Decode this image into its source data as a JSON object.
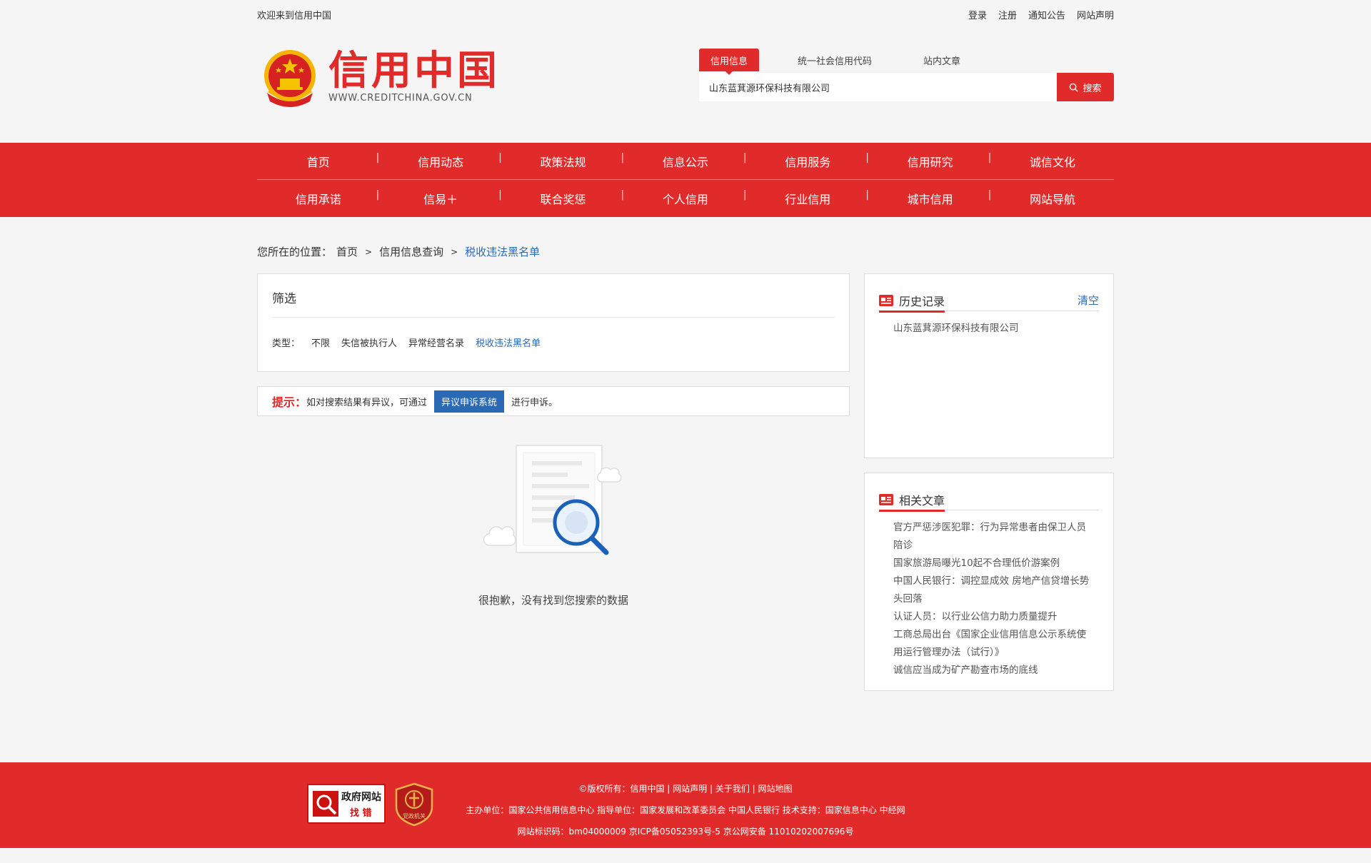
{
  "topbar": {
    "welcome": "欢迎来到信用中国",
    "links": [
      "登录",
      "注册",
      "通知公告",
      "网站声明"
    ]
  },
  "logo": {
    "title": "信用中国",
    "subtitle": "WWW.CREDITCHINA.GOV.CN"
  },
  "search": {
    "tabs": [
      "信用信息",
      "统一社会信用代码",
      "站内文章"
    ],
    "active_tab": "信用信息",
    "value": "山东蓝萁源环保科技有限公司",
    "button": "搜索"
  },
  "nav": {
    "row1": [
      "首页",
      "信用动态",
      "政策法规",
      "信息公示",
      "信用服务",
      "信用研究",
      "诚信文化"
    ],
    "row2": [
      "信用承诺",
      "信易＋",
      "联合奖惩",
      "个人信用",
      "行业信用",
      "城市信用",
      "网站导航"
    ]
  },
  "breadcrumb": {
    "prefix": "您所在的位置：",
    "items": [
      "首页",
      "信用信息查询"
    ],
    "current": "税收违法黑名单"
  },
  "filter": {
    "title": "筛选",
    "label": "类型：",
    "options": [
      "不限",
      "失信被执行人",
      "异常经营名录",
      "税收违法黑名单"
    ],
    "active": "税收违法黑名单"
  },
  "notice": {
    "label": "提示：",
    "text_before": "如对搜索结果有异议，可通过",
    "button": "异议申诉系统",
    "text_after": "进行申诉。"
  },
  "empty": {
    "text": "很抱歉，没有找到您搜索的数据"
  },
  "history": {
    "title": "历史记录",
    "clear": "清空",
    "items": [
      "山东蓝萁源环保科技有限公司"
    ]
  },
  "related": {
    "title": "相关文章",
    "items": [
      "官方严惩涉医犯罪：行为异常患者由保卫人员陪诊",
      "国家旅游局曝光10起不合理低价游案例",
      "中国人民银行：调控显成效 房地产信贷增长势头回落",
      "认证人员：以行业公信力助力质量提升",
      "工商总局出台《国家企业信用信息公示系统使用运行管理办法（试行）》",
      "诚信应当成为矿产勘查市场的底线"
    ]
  },
  "footer": {
    "badge1_line1": "政府网站",
    "badge1_line2": "找 错",
    "badge2": "党政机关",
    "line1": "©版权所有：信用中国 | 网站声明 | 关于我们 | 网站地图",
    "line2": "主办单位：国家公共信用信息中心   指导单位：国家发展和改革委员会 中国人民银行   技术支持：国家信息中心 中经网",
    "line3": "网站标识码：bm04000009 京ICP备05052393号-5 京公网安备 11010202007696号"
  },
  "colors": {
    "brand_red": "#e12b2b",
    "link_blue": "#2a6ab5"
  }
}
